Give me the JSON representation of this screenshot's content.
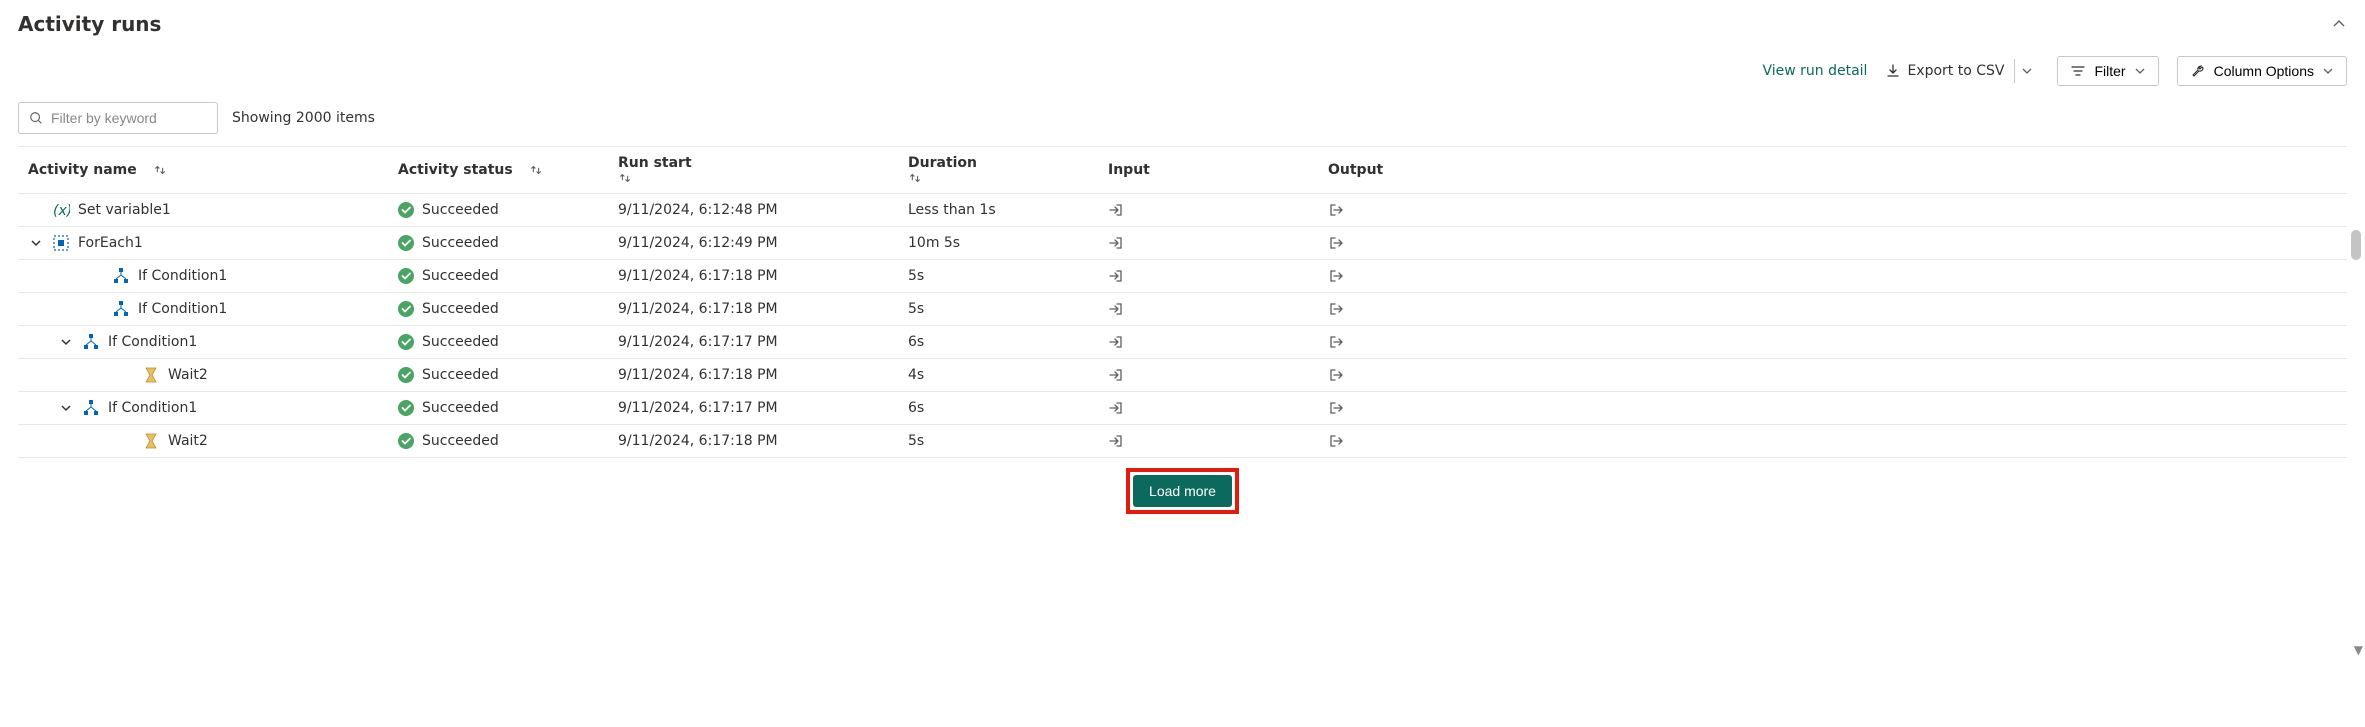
{
  "title": "Activity runs",
  "toolbar": {
    "view_detail": "View run detail",
    "export": "Export to CSV",
    "filter": "Filter",
    "column_options": "Column Options"
  },
  "search": {
    "placeholder": "Filter by keyword",
    "value": ""
  },
  "count_text": "Showing 2000 items",
  "columns": {
    "name": "Activity name",
    "status": "Activity status",
    "start": "Run start",
    "duration": "Duration",
    "input": "Input",
    "output": "Output"
  },
  "rows": [
    {
      "indent": 0,
      "toggle": "",
      "icon": "variable",
      "name": "Set variable1",
      "status": "Succeeded",
      "start": "9/11/2024, 6:12:48 PM",
      "duration": "Less than 1s"
    },
    {
      "indent": 0,
      "toggle": "down",
      "icon": "foreach",
      "name": "ForEach1",
      "status": "Succeeded",
      "start": "9/11/2024, 6:12:49 PM",
      "duration": "10m 5s"
    },
    {
      "indent": 2,
      "toggle": "",
      "icon": "condition",
      "name": "If Condition1",
      "status": "Succeeded",
      "start": "9/11/2024, 6:17:18 PM",
      "duration": "5s"
    },
    {
      "indent": 2,
      "toggle": "",
      "icon": "condition",
      "name": "If Condition1",
      "status": "Succeeded",
      "start": "9/11/2024, 6:17:18 PM",
      "duration": "5s"
    },
    {
      "indent": 1,
      "toggle": "down",
      "icon": "condition",
      "name": "If Condition1",
      "status": "Succeeded",
      "start": "9/11/2024, 6:17:17 PM",
      "duration": "6s"
    },
    {
      "indent": 3,
      "toggle": "",
      "icon": "wait",
      "name": "Wait2",
      "status": "Succeeded",
      "start": "9/11/2024, 6:17:18 PM",
      "duration": "4s"
    },
    {
      "indent": 1,
      "toggle": "down",
      "icon": "condition",
      "name": "If Condition1",
      "status": "Succeeded",
      "start": "9/11/2024, 6:17:17 PM",
      "duration": "6s"
    },
    {
      "indent": 3,
      "toggle": "",
      "icon": "wait",
      "name": "Wait2",
      "status": "Succeeded",
      "start": "9/11/2024, 6:17:18 PM",
      "duration": "5s"
    }
  ],
  "load_more": "Load more"
}
